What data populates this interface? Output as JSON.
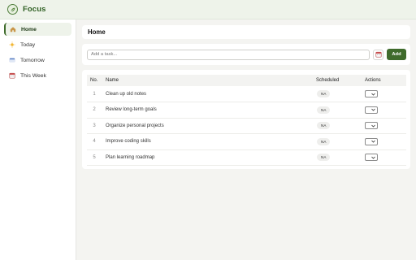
{
  "app": {
    "title": "Focus",
    "logo_icon": "leaf-globe-icon"
  },
  "sidebar": {
    "items": [
      {
        "label": "Home",
        "icon": "home-icon",
        "active": true
      },
      {
        "label": "Today",
        "icon": "sun-icon",
        "active": false
      },
      {
        "label": "Tomorrow",
        "icon": "calendar-strip-icon",
        "active": false
      },
      {
        "label": "This Week",
        "icon": "calendar-icon",
        "active": false
      }
    ]
  },
  "main": {
    "title": "Home",
    "input": {
      "placeholder": "Add a task...",
      "value": ""
    },
    "add_label": "Add",
    "table": {
      "columns": {
        "no": "No.",
        "name": "Name",
        "scheduled": "Scheduled",
        "actions": "Actions"
      },
      "rows": [
        {
          "no": "1",
          "name": "Clean up old notes",
          "scheduled": "NA"
        },
        {
          "no": "2",
          "name": "Review long-term goals",
          "scheduled": "NA"
        },
        {
          "no": "3",
          "name": "Organize personal projects",
          "scheduled": "NA"
        },
        {
          "no": "4",
          "name": "Improve coding skills",
          "scheduled": "NA"
        },
        {
          "no": "5",
          "name": "Plan learning roadmap",
          "scheduled": "NA"
        }
      ]
    }
  },
  "colors": {
    "accent": "#3f6b2c",
    "topbar": "#eef3ea",
    "background": "#f4f4f1"
  }
}
